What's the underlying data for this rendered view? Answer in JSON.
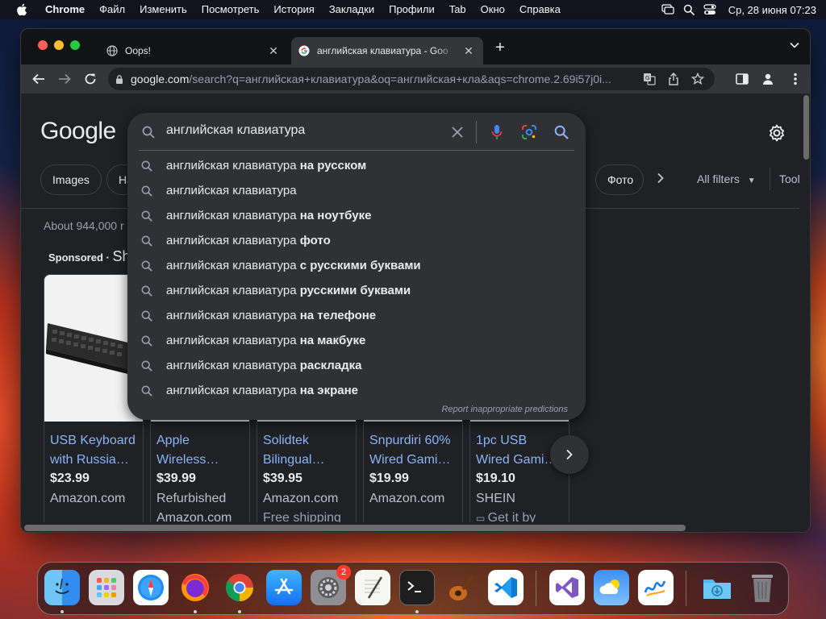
{
  "menubar": {
    "app": "Chrome",
    "items": [
      "Файл",
      "Изменить",
      "Посмотреть",
      "История",
      "Закладки",
      "Профили",
      "Tab",
      "Окно",
      "Справка"
    ],
    "clock": "Ср, 28 июня  07:23",
    "status_icons": [
      "screen-mirror-icon",
      "spotlight-search-icon",
      "control-center-icon"
    ]
  },
  "browser": {
    "tabs": [
      {
        "title": "Oops!",
        "favicon": "globe-icon"
      },
      {
        "title": "английская клавиатура - Goo",
        "favicon": "google-g-icon",
        "active": true
      }
    ],
    "url": {
      "host": "google.com",
      "path": "/search?q=английская+клавиатура&oq=английская+кла&aqs=chrome.2.69i57j0i..."
    }
  },
  "page": {
    "logo": "Google",
    "chips": {
      "images": "Images",
      "partial": "Ha",
      "foto": "Фото"
    },
    "all_filters": "All filters",
    "tools": "Tool",
    "result_stats": "About 944,000 r",
    "sponsored": "Sponsored",
    "sponsored_sep": " · ",
    "sponsored_shop": "Sh",
    "products": [
      {
        "title1": "USB Keyboard",
        "title2": "with Russia…",
        "price": "$23.99",
        "store": "Amazon.com",
        "extra": ""
      },
      {
        "title1": "Apple",
        "title2": "Wireless…",
        "price": "$39.99",
        "store": "Refurbished",
        "extra": "Amazon.com"
      },
      {
        "title1": "Solidtek",
        "title2": "Bilingual…",
        "price": "$39.95",
        "store": "Amazon.com",
        "extra": "Free shipping"
      },
      {
        "title1": "Snpurdiri 60%",
        "title2": "Wired Gami…",
        "price": "$19.99",
        "store": "Amazon.com",
        "extra": ""
      },
      {
        "title1": "1pc USB",
        "title2": "Wired Gami…",
        "price": "$19.10",
        "store": "SHEIN",
        "extra": "Get it by"
      }
    ]
  },
  "search": {
    "query": "английская клавиатура",
    "suggestions": [
      {
        "base": "английская клавиатура",
        "bold": " на русском"
      },
      {
        "base": "английская клавиатура",
        "bold": ""
      },
      {
        "base": "английская клавиатура",
        "bold": " на ноутбуке"
      },
      {
        "base": "английская клавиатура",
        "bold": " фото"
      },
      {
        "base": "английская клавиатура",
        "bold": " с русскими буквами"
      },
      {
        "base": "английская клавиатура",
        "bold": " русскими буквами"
      },
      {
        "base": "английская клавиатура",
        "bold": " на телефоне"
      },
      {
        "base": "английская клавиатура",
        "bold": " на макбуке"
      },
      {
        "base": "английская клавиатура",
        "bold": " раскладка"
      },
      {
        "base": "английская клавиатура",
        "bold": " на экране"
      }
    ],
    "report": "Report inappropriate predictions"
  },
  "dock": {
    "apps": [
      "finder-icon",
      "launchpad-icon",
      "safari-icon",
      "firefox-icon",
      "chrome-icon",
      "app-store-icon",
      "system-settings-icon",
      "textedit-icon",
      "terminal-icon",
      "garageband-icon",
      "vscode-icon",
      "visual-studio-icon",
      "weather-icon",
      "freeform-icon",
      "downloads-folder-icon",
      "trash-icon"
    ],
    "settings_badge": "2"
  },
  "colors": {
    "link": "#8ab4f8",
    "bg": "#202124",
    "dropdown": "#303134"
  }
}
